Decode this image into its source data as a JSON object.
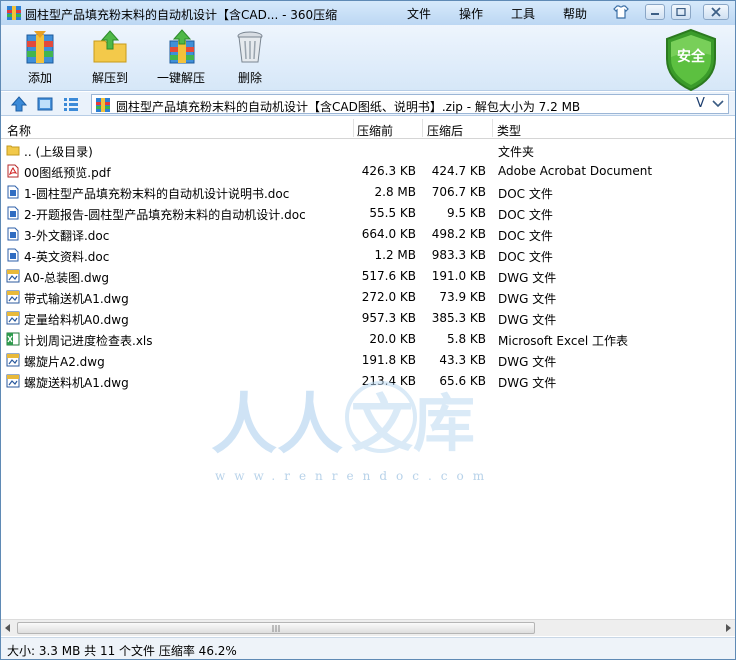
{
  "window": {
    "title": "圆柱型产品填充粉末料的自动机设计【含CAD... - 360压缩",
    "menu": [
      "文件",
      "操作",
      "工具",
      "帮助"
    ]
  },
  "toolbar": {
    "add": "添加",
    "extract": "解压到",
    "quick_extract": "一键解压",
    "delete": "删除",
    "security": "安全"
  },
  "address": {
    "path": "圆柱型产品填充粉末料的自动机设计【含CAD图纸、说明书】.zip - 解包大小为 7.2 MB",
    "v": "V"
  },
  "columns": {
    "name": "名称",
    "size": "压缩前",
    "csize": "压缩后",
    "type": "类型"
  },
  "files": [
    {
      "name": ".. (上级目录)",
      "size": "",
      "csize": "",
      "type": "文件夹",
      "icon": "folder-icon"
    },
    {
      "name": "00图纸预览.pdf",
      "size": "426.3 KB",
      "csize": "424.7 KB",
      "type": "Adobe Acrobat Document",
      "icon": "pdf-icon"
    },
    {
      "name": "1-圆柱型产品填充粉末料的自动机设计说明书.doc",
      "size": "2.8 MB",
      "csize": "706.7 KB",
      "type": "DOC 文件",
      "icon": "doc-icon"
    },
    {
      "name": "2-开题报告-圆柱型产品填充粉末料的自动机设计.doc",
      "size": "55.5 KB",
      "csize": "9.5 KB",
      "type": "DOC 文件",
      "icon": "doc-icon"
    },
    {
      "name": "3-外文翻译.doc",
      "size": "664.0 KB",
      "csize": "498.2 KB",
      "type": "DOC 文件",
      "icon": "doc-icon"
    },
    {
      "name": "4-英文资料.doc",
      "size": "1.2 MB",
      "csize": "983.3 KB",
      "type": "DOC 文件",
      "icon": "doc-icon"
    },
    {
      "name": "A0-总装图.dwg",
      "size": "517.6 KB",
      "csize": "191.0 KB",
      "type": "DWG 文件",
      "icon": "dwg-icon"
    },
    {
      "name": "带式输送机A1.dwg",
      "size": "272.0 KB",
      "csize": "73.9 KB",
      "type": "DWG 文件",
      "icon": "dwg-icon"
    },
    {
      "name": "定量给料机A0.dwg",
      "size": "957.3 KB",
      "csize": "385.3 KB",
      "type": "DWG 文件",
      "icon": "dwg-icon"
    },
    {
      "name": "计划周记进度检查表.xls",
      "size": "20.0 KB",
      "csize": "5.8 KB",
      "type": "Microsoft Excel 工作表",
      "icon": "xls-icon"
    },
    {
      "name": "螺旋片A2.dwg",
      "size": "191.8 KB",
      "csize": "43.3 KB",
      "type": "DWG 文件",
      "icon": "dwg-icon"
    },
    {
      "name": "螺旋送料机A1.dwg",
      "size": "213.4 KB",
      "csize": "65.6 KB",
      "type": "DWG 文件",
      "icon": "dwg-icon"
    }
  ],
  "watermark": {
    "text": "人人文库",
    "url": "www.renrendoc.com"
  },
  "status": {
    "text": "大小: 3.3 MB 共 11 个文件 压缩率 46.2%"
  }
}
